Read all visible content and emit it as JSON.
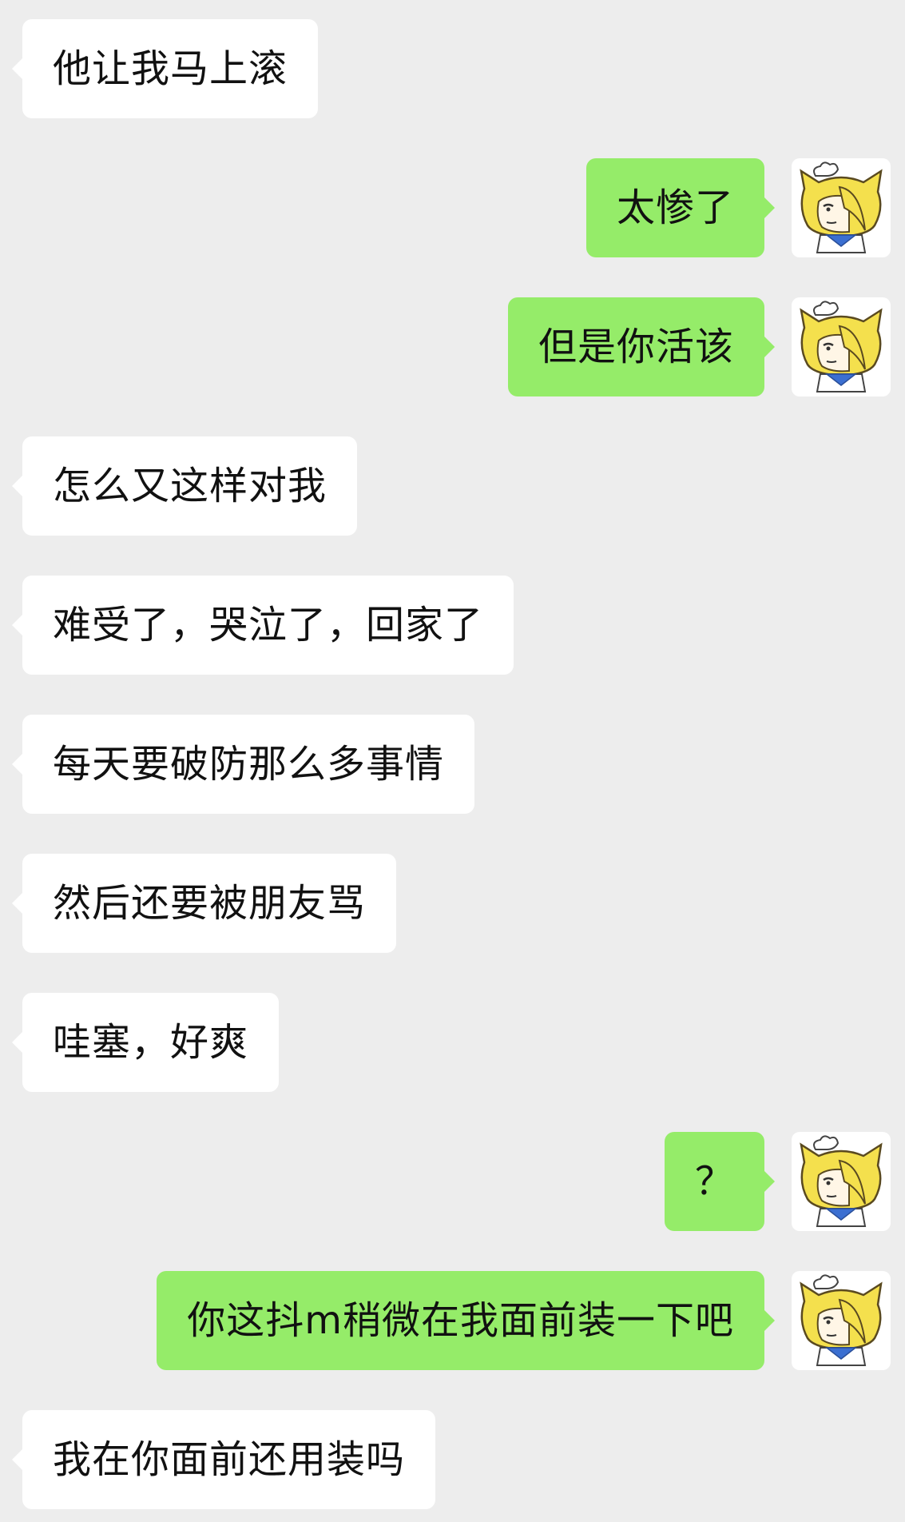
{
  "colors": {
    "background": "#ededed",
    "incoming_bubble": "#ffffff",
    "outgoing_bubble": "#95ec69",
    "text": "#111111",
    "avatar_hair": "#f4e04d"
  },
  "messages": [
    {
      "side": "left",
      "text": "他让我马上滚"
    },
    {
      "side": "right",
      "text": "太惨了"
    },
    {
      "side": "right",
      "text": "但是你活该"
    },
    {
      "side": "left",
      "text": "怎么又这样对我"
    },
    {
      "side": "left",
      "text": "难受了，哭泣了，回家了"
    },
    {
      "side": "left",
      "text": "每天要破防那么多事情"
    },
    {
      "side": "left",
      "text": "然后还要被朋友骂"
    },
    {
      "side": "left",
      "text": "哇塞，好爽"
    },
    {
      "side": "right",
      "text": "？"
    },
    {
      "side": "right",
      "text": "你这抖m稍微在我面前装一下吧"
    },
    {
      "side": "left",
      "text": "我在你面前还用装吗"
    }
  ],
  "avatar": {
    "icon": "cartoon-blonde-chef-avatar-icon"
  }
}
